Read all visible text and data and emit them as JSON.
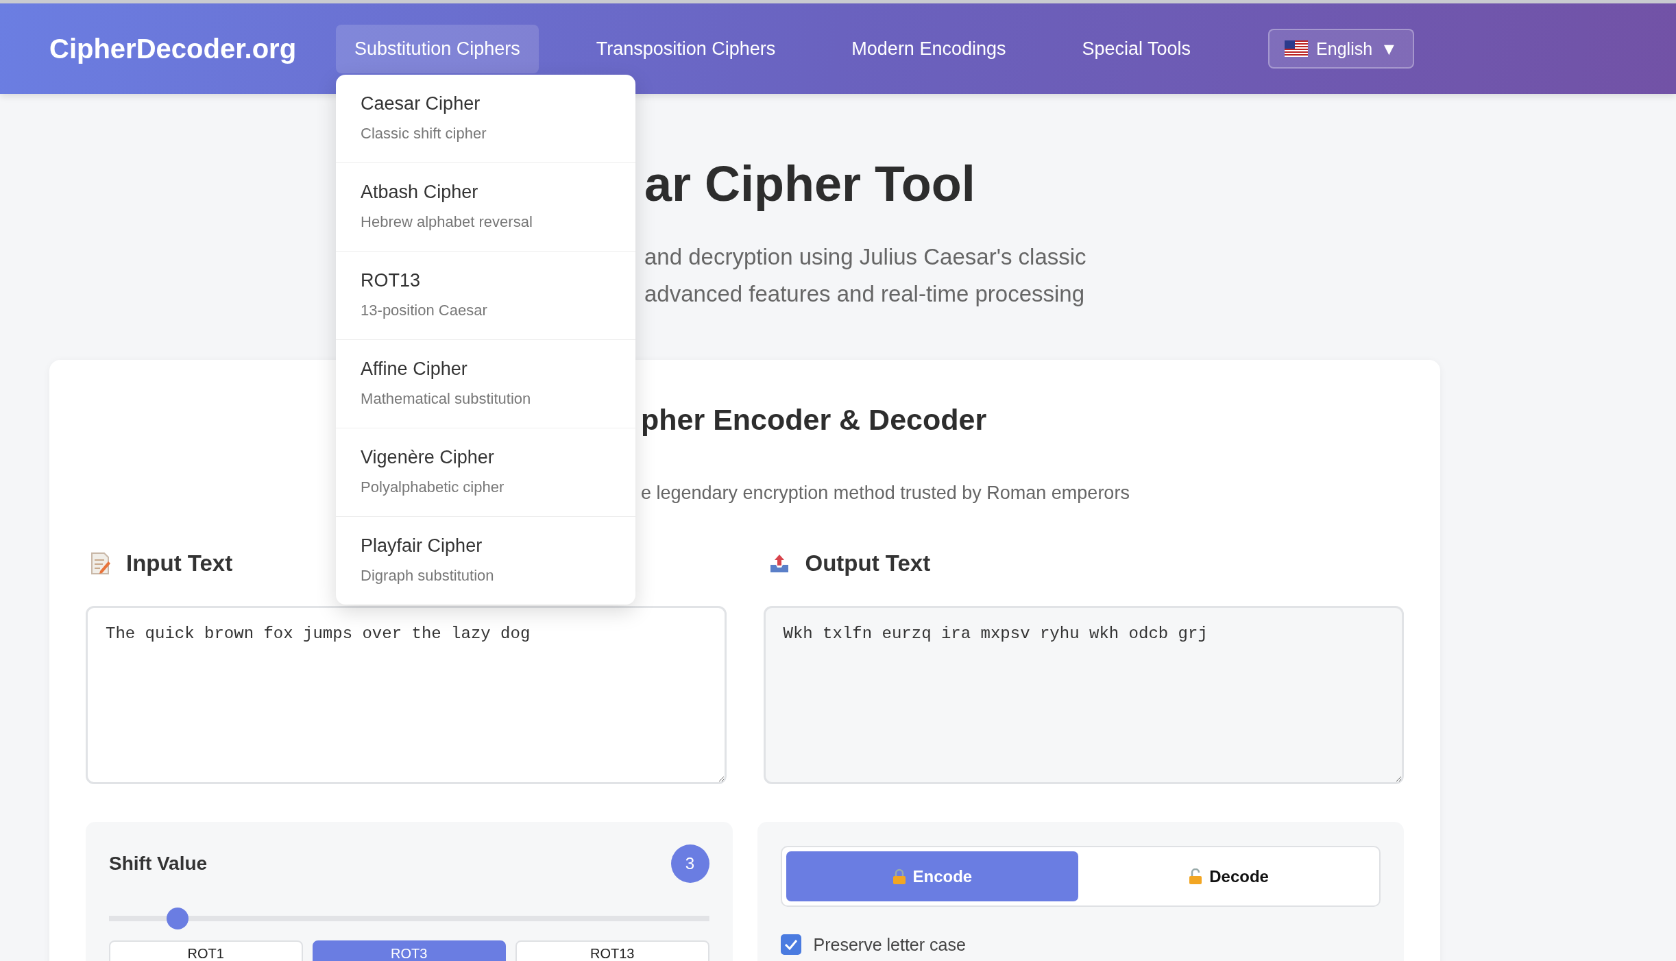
{
  "header": {
    "logo": "CipherDecoder.org",
    "nav": [
      {
        "label": "Substitution Ciphers",
        "selected": true,
        "menu": [
          {
            "title": "Caesar Cipher",
            "subtitle": "Classic shift cipher"
          },
          {
            "title": "Atbash Cipher",
            "subtitle": "Hebrew alphabet reversal"
          },
          {
            "title": "ROT13",
            "subtitle": "13-position Caesar"
          },
          {
            "title": "Affine Cipher",
            "subtitle": "Mathematical substitution"
          },
          {
            "title": "Vigenère Cipher",
            "subtitle": "Polyalphabetic cipher"
          },
          {
            "title": "Playfair Cipher",
            "subtitle": "Digraph substitution"
          }
        ]
      },
      {
        "label": "Transposition Ciphers",
        "selected": false
      },
      {
        "label": "Modern Encodings",
        "selected": false
      },
      {
        "label": "Special Tools",
        "selected": false
      }
    ],
    "language": {
      "label": "English",
      "caret": "▼"
    }
  },
  "hero": {
    "title": "ar Cipher Tool",
    "subtitle_lines": [
      "and decryption using Julius Caesar's classic",
      "advanced features and real-time processing"
    ]
  },
  "tool": {
    "heading": "pher Encoder & Decoder",
    "description": "e legendary encryption method trusted by Roman emperors",
    "input": {
      "label": "Input Text",
      "value": "The quick brown fox jumps over the lazy dog"
    },
    "output": {
      "label": "Output Text",
      "value": "Wkh txlfn eurzq ira mxpsv ryhu wkh odcb grj"
    },
    "shift": {
      "label": "Shift Value",
      "value": "3",
      "level": 0.1,
      "presets": [
        {
          "label": "ROT1",
          "selected": false
        },
        {
          "label": "ROT3",
          "selected": true
        },
        {
          "label": "ROT13",
          "selected": false
        }
      ]
    },
    "modes": [
      {
        "label": "Encode",
        "selected": true,
        "kind": "locked"
      },
      {
        "label": "Decode",
        "selected": false,
        "kind": "unlocked"
      }
    ],
    "options": [
      {
        "label": "Preserve letter case",
        "checked": true
      }
    ]
  }
}
